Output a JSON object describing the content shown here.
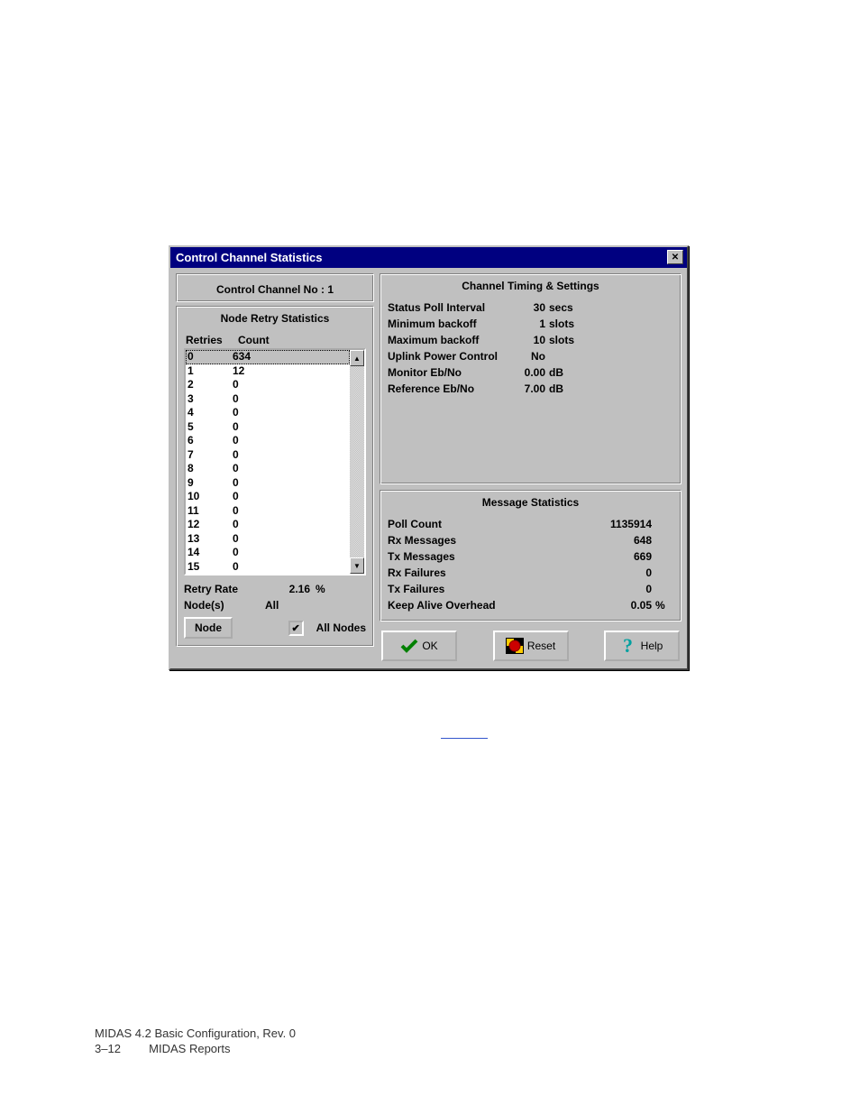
{
  "dialog": {
    "title": "Control Channel Statistics",
    "channel_no_label": "Control Channel No :  1"
  },
  "retry": {
    "group_title": "Node Retry Statistics",
    "col1": "Retries",
    "col2": "Count",
    "rows": [
      {
        "r": "0",
        "c": "634"
      },
      {
        "r": "1",
        "c": "12"
      },
      {
        "r": "2",
        "c": "0"
      },
      {
        "r": "3",
        "c": "0"
      },
      {
        "r": "4",
        "c": "0"
      },
      {
        "r": "5",
        "c": "0"
      },
      {
        "r": "6",
        "c": "0"
      },
      {
        "r": "7",
        "c": "0"
      },
      {
        "r": "8",
        "c": "0"
      },
      {
        "r": "9",
        "c": "0"
      },
      {
        "r": "10",
        "c": "0"
      },
      {
        "r": "11",
        "c": "0"
      },
      {
        "r": "12",
        "c": "0"
      },
      {
        "r": "13",
        "c": "0"
      },
      {
        "r": "14",
        "c": "0"
      },
      {
        "r": "15",
        "c": "0"
      }
    ],
    "retry_rate_label": "Retry Rate",
    "retry_rate_value": "2.16",
    "retry_rate_unit": "%",
    "nodes_label": "Node(s)",
    "nodes_value": "All",
    "node_button": "Node",
    "all_nodes_label": "All Nodes"
  },
  "timing": {
    "title": "Channel Timing & Settings",
    "items": [
      {
        "k": "Status Poll Interval",
        "v": "30",
        "u": "secs"
      },
      {
        "k": "Minimum backoff",
        "v": "1",
        "u": "slots"
      },
      {
        "k": "Maximum backoff",
        "v": "10",
        "u": "slots"
      },
      {
        "k": "Uplink Power Control",
        "v": "No",
        "u": ""
      },
      {
        "k": "Monitor Eb/No",
        "v": "0.00",
        "u": "dB"
      },
      {
        "k": "Reference Eb/No",
        "v": "7.00",
        "u": "dB"
      }
    ]
  },
  "msg": {
    "title": "Message Statistics",
    "items": [
      {
        "k": "Poll Count",
        "v": "1135914",
        "u": ""
      },
      {
        "k": "Rx Messages",
        "v": "648",
        "u": ""
      },
      {
        "k": "Tx Messages",
        "v": "669",
        "u": ""
      },
      {
        "k": "Rx Failures",
        "v": "0",
        "u": ""
      },
      {
        "k": "Tx Failures",
        "v": "0",
        "u": ""
      },
      {
        "k": "Keep Alive Overhead",
        "v": "0.05",
        "u": "%"
      }
    ]
  },
  "buttons": {
    "ok": "OK",
    "reset": "Reset",
    "help": "Help"
  },
  "footer": {
    "l1": "MIDAS 4.2 Basic Configuration, Rev. 0",
    "l2a": "3–12",
    "l2b": "MIDAS Reports"
  }
}
